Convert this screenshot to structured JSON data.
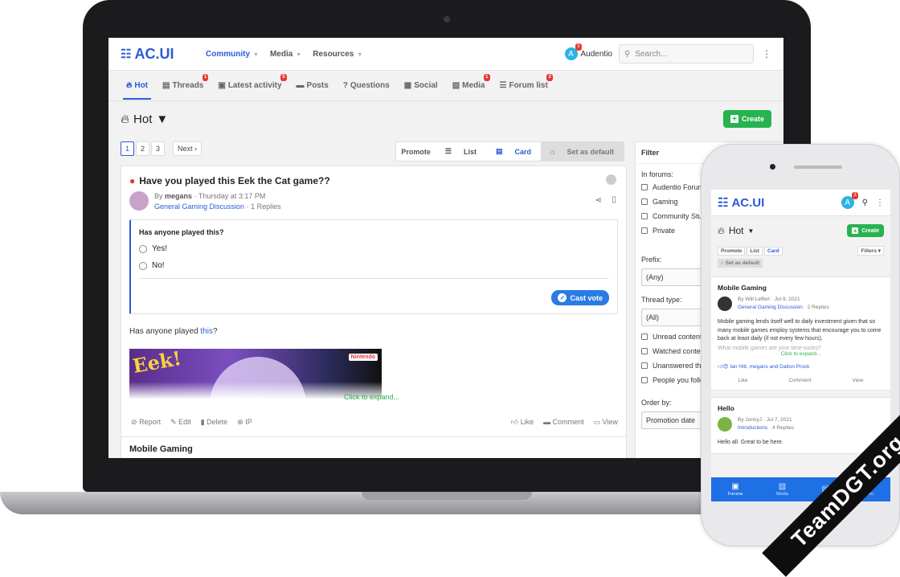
{
  "app": {
    "logo_text": "AC.UI"
  },
  "topnav": {
    "items": [
      {
        "label": "Community"
      },
      {
        "label": "Media"
      },
      {
        "label": "Resources"
      }
    ],
    "user_name": "Audentio",
    "user_initial": "A",
    "alerts_count": "3",
    "search_placeholder": "Search..."
  },
  "subnav": {
    "tabs": [
      {
        "label": "Hot",
        "badge": ""
      },
      {
        "label": "Threads",
        "badge": "1"
      },
      {
        "label": "Latest activity",
        "badge": "5"
      },
      {
        "label": "Posts",
        "badge": ""
      },
      {
        "label": "Questions",
        "badge": ""
      },
      {
        "label": "Social",
        "badge": ""
      },
      {
        "label": "Media",
        "badge": "1"
      },
      {
        "label": "Forum list",
        "badge": "2"
      }
    ]
  },
  "page": {
    "title": "Hot",
    "create_label": "Create"
  },
  "pagination": {
    "pages": [
      "1",
      "2",
      "3"
    ],
    "next_label": "Next ›"
  },
  "views": {
    "promote": "Promote",
    "list": "List",
    "card": "Card",
    "set_default": "Set as default"
  },
  "post1": {
    "title": "Have you played this Eek the Cat game??",
    "by": "By",
    "author": "megans",
    "time": "Thursday at 3:17 PM",
    "forum": "General Gaming Discussion",
    "replies": "1 Replies",
    "poll_question": "Has anyone played this?",
    "poll_options": [
      "Yes!",
      "No!"
    ],
    "cast_vote": "Cast vote",
    "body_prefix": "Has anyone played ",
    "body_link": "this",
    "body_suffix": "?",
    "image_text": "Eek!",
    "image_brand": "Nintendo",
    "expand": "Click to expand...",
    "actions": {
      "report": "Report",
      "edit": "Edit",
      "delete": "Delete",
      "ip": "IP",
      "like": "Like",
      "comment": "Comment",
      "view": "View"
    }
  },
  "post2": {
    "title": "Mobile Gaming"
  },
  "filter": {
    "title": "Filter",
    "in_forums_label": "In forums:",
    "forums": [
      "Audentio Forum",
      "Gaming",
      "Community Stuff",
      "Private"
    ],
    "prefix_label": "Prefix:",
    "prefix_value": "(Any)",
    "thread_type_label": "Thread type:",
    "thread_type_value": "(All)",
    "checks": [
      "Unread content",
      "Watched content",
      "Unanswered threads",
      "People you follow"
    ],
    "order_label": "Order by:",
    "order_value": "Promotion date"
  },
  "phone": {
    "logo_text": "AC.UI",
    "title": "Hot",
    "create_label": "Create",
    "views": {
      "promote": "Promote",
      "list": "List",
      "card": "Card",
      "filters": "Filters ▾",
      "set_default": "Set as default"
    },
    "card1": {
      "title": "Mobile Gaming",
      "meta_line1": "By Will Leffert · Jul 9, 2021",
      "forum": "General Gaming Discussion",
      "replies": "· 2 Replies",
      "body": "Mobile gaming lends itself well to daily investment given that so many mobile games employ systems that encourage you to come back at least daily (if not every few hours).",
      "body_faded": "What mobile games are your time-sucks?",
      "expand": "Click to expand...",
      "reactions": "Ian Hitt, megans and Dalton Prock",
      "like": "Like",
      "comment": "Comment",
      "view": "View"
    },
    "card2": {
      "title": "Hello",
      "meta_line1": "By JonnyJ · Jul 7, 2021",
      "forum": "Introductions",
      "replies": "· 4 Replies",
      "body": "Hello all. Great to be here."
    },
    "bottom_nav": [
      {
        "label": "Forums"
      },
      {
        "label": "Media"
      },
      {
        "label": ""
      },
      {
        "label": "Menu"
      }
    ]
  },
  "watermark": "TeamDGT.org"
}
